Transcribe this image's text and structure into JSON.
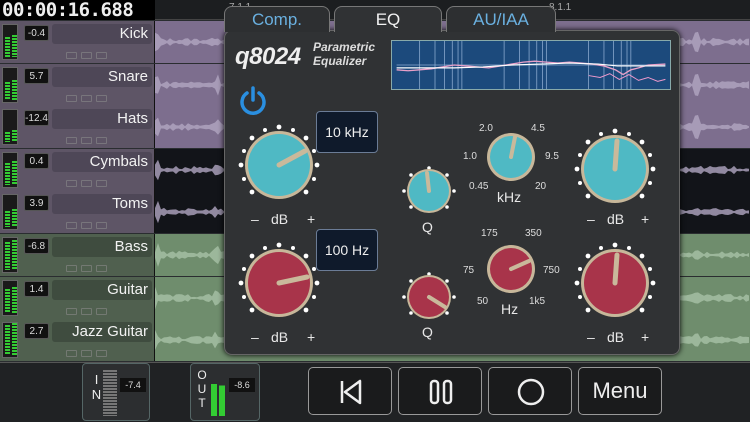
{
  "transport": {
    "timecode": "00:00:16.688"
  },
  "ruler": {
    "marks": [
      "7.1.1",
      "8.1.1"
    ]
  },
  "tracks": [
    {
      "name": "Kick",
      "volume": "-0.4",
      "color": "purple"
    },
    {
      "name": "Snare",
      "volume": "5.7",
      "color": "purple"
    },
    {
      "name": "Hats",
      "volume": "-12.4",
      "color": "purple"
    },
    {
      "name": "Cymbals",
      "volume": "0.4",
      "color": "purple"
    },
    {
      "name": "Toms",
      "volume": "3.9",
      "color": "purple"
    },
    {
      "name": "Bass",
      "volume": "-6.8",
      "color": "green"
    },
    {
      "name": "Guitar",
      "volume": "1.4",
      "color": "green"
    },
    {
      "name": "Jazz Guitar",
      "volume": "2.7",
      "color": "green"
    }
  ],
  "plugin": {
    "tabs": [
      "Comp.",
      "EQ",
      "AU/IAA"
    ],
    "active_tab": "EQ",
    "brand": "q8024",
    "subtitle_line1": "Parametric",
    "subtitle_line2": "Equalizer",
    "high_freq": "10 kHz",
    "low_freq": "100 Hz",
    "db_label": "dB",
    "minus": "–",
    "plus": "+",
    "q_label": "Q",
    "khz_label": "kHz",
    "hz_label": "Hz",
    "khz_scale": [
      "2.0",
      "4.5",
      "1.0",
      "9.5",
      "0.45",
      "20"
    ],
    "hz_scale": [
      "175",
      "350",
      "75",
      "750",
      "50",
      "1k5"
    ],
    "power_on": true,
    "colors": {
      "cyan": "#4fb9c4",
      "red": "#a8344a",
      "accent": "#2a8fe0"
    }
  },
  "bottom": {
    "in_label": "IN",
    "in_level": "-7.4",
    "out_label": "OUT",
    "out_level": "-8.6",
    "menu_label": "Menu",
    "buttons": [
      "rewind-icon",
      "pause-icon",
      "record-icon"
    ]
  }
}
